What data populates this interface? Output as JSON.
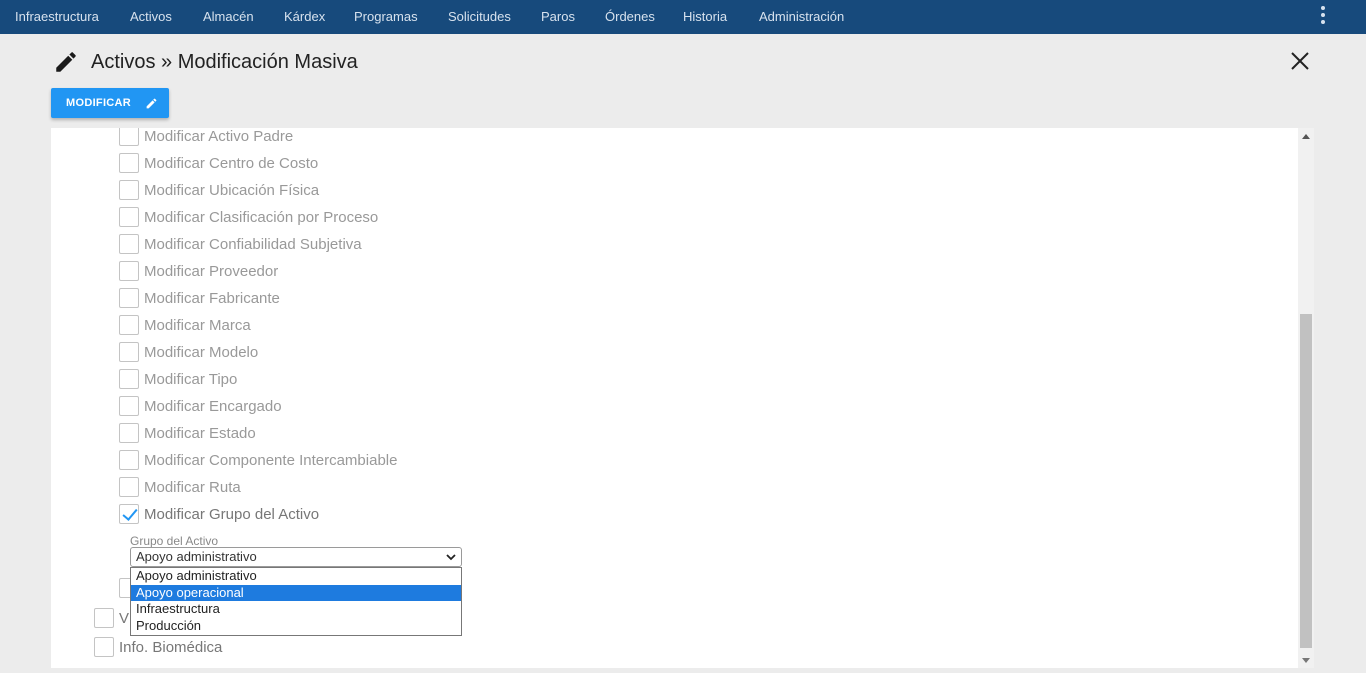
{
  "nav": {
    "items": [
      "Infraestructura",
      "Activos",
      "Almacén",
      "Kárdex",
      "Programas",
      "Solicitudes",
      "Paros",
      "Órdenes",
      "Historia",
      "Administración"
    ]
  },
  "header": {
    "title": "Activos » Modificación Masiva"
  },
  "toolbar": {
    "modify_label": "MODIFICAR"
  },
  "options": [
    {
      "label": "Modificar Activo Padre",
      "checked": false
    },
    {
      "label": "Modificar Centro de Costo",
      "checked": false
    },
    {
      "label": "Modificar Ubicación Física",
      "checked": false
    },
    {
      "label": "Modificar Clasificación por Proceso",
      "checked": false
    },
    {
      "label": "Modificar Confiabilidad Subjetiva",
      "checked": false
    },
    {
      "label": "Modificar Proveedor",
      "checked": false
    },
    {
      "label": "Modificar Fabricante",
      "checked": false
    },
    {
      "label": "Modificar Marca",
      "checked": false
    },
    {
      "label": "Modificar Modelo",
      "checked": false
    },
    {
      "label": "Modificar Tipo",
      "checked": false
    },
    {
      "label": "Modificar Encargado",
      "checked": false
    },
    {
      "label": "Modificar Estado",
      "checked": false
    },
    {
      "label": "Modificar Componente Intercambiable",
      "checked": false
    },
    {
      "label": "Modificar Ruta",
      "checked": false
    },
    {
      "label": "Modificar Grupo del Activo",
      "checked": true
    }
  ],
  "group_field": {
    "label": "Grupo del Activo",
    "value": "Apoyo administrativo",
    "options": [
      "Apoyo administrativo",
      "Apoyo operacional",
      "Infraestructura",
      "Producción"
    ],
    "highlighted": "Apoyo operacional"
  },
  "sections": [
    {
      "label": "V",
      "checked": false
    },
    {
      "label": "Info. Biomédica",
      "checked": false
    }
  ],
  "colors": {
    "nav_bg": "#174a7c",
    "accent": "#2196f3",
    "highlight": "#1e7bdf"
  }
}
